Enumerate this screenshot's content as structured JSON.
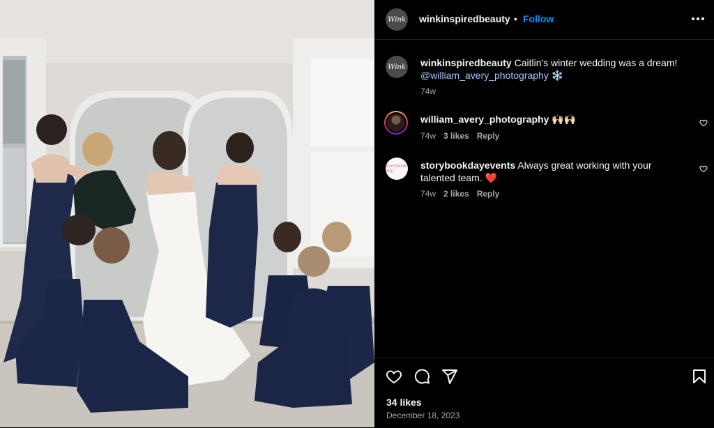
{
  "post": {
    "username": "winkinspiredbeauty",
    "separator": "•",
    "follow_label": "Follow",
    "avatar_text": "Wink"
  },
  "caption": {
    "username": "winkinspiredbeauty",
    "text": "Caitlin's winter wedding was a dream!",
    "mention": "@william_avery_photography",
    "emoji": "❄️",
    "time": "74w"
  },
  "comments": [
    {
      "username": "william_avery_photography",
      "text": "🙌🏻🙌🏻",
      "time": "74w",
      "likes": "3 likes",
      "reply": "Reply"
    },
    {
      "username": "storybookdayevents",
      "text_line1": "Always great working with your",
      "text_line2": "talented team.",
      "emoji": "❤️",
      "time": "74w",
      "likes": "2 likes",
      "reply": "Reply",
      "avatar_text": "storybook day"
    }
  ],
  "footer": {
    "likes": "34 likes",
    "date": "December 18, 2023"
  },
  "icons": [
    "heart-icon",
    "comment-icon",
    "share-icon",
    "bookmark-icon",
    "more-icon"
  ],
  "colors": {
    "accent": "#0095f6",
    "background": "#000000",
    "muted": "#a8a8a8"
  }
}
